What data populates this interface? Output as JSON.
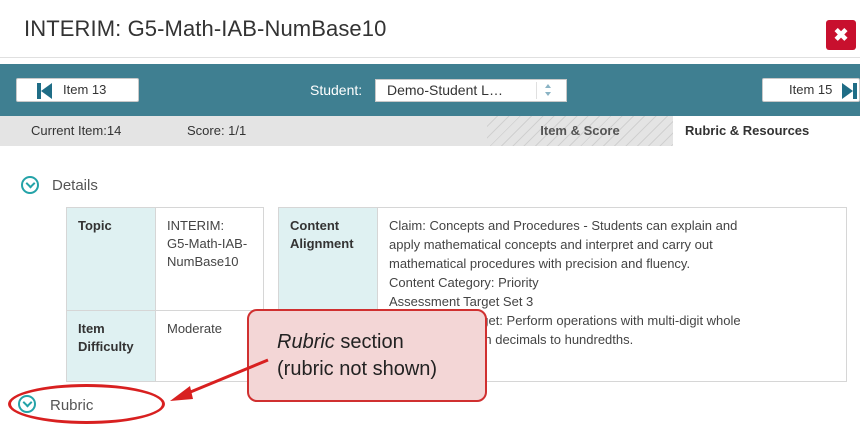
{
  "window": {
    "title": "INTERIM: G5-Math-IAB-NumBase10",
    "close_symbol": "✖"
  },
  "nav": {
    "prev_label": "Item 13",
    "student_label": "Student:",
    "student_value": "Demo-Student L…",
    "next_label": "Item 15"
  },
  "info": {
    "current_item": "Current Item:14",
    "score": "Score: 1/1",
    "tab_item_score": "Item & Score",
    "tab_rubric": "Rubric & Resources"
  },
  "details": {
    "label": "Details",
    "topic_head": "Topic",
    "topic_value": "INTERIM: G5-Math-IAB-NumBase10",
    "difficulty_head": "Item Difficulty",
    "difficulty_value": "Moderate",
    "alignment_head": "Content Alignment",
    "alignment_lines": [
      "Claim: Concepts and Procedures - Students can explain and",
      "apply mathematical concepts and interpret and carry out",
      "mathematical procedures with precision and fluency.",
      "Content Category: Priority",
      "Assessment Target Set 3",
      "Assessment Target: Perform operations with multi-digit whole",
      "numbers and with decimals to hundredths."
    ]
  },
  "rubric": {
    "label": "Rubric"
  },
  "callout": {
    "italic": "Rubric",
    "line1_rest": " section",
    "line2": "(rubric not shown)"
  },
  "colors": {
    "nav_bar": "#3f7f91",
    "teal_accent": "#24a3a8",
    "close_red": "#c8102e",
    "callout_border": "#d03030",
    "callout_fill": "#f3d6d6",
    "table_head": "#dff1f2"
  }
}
